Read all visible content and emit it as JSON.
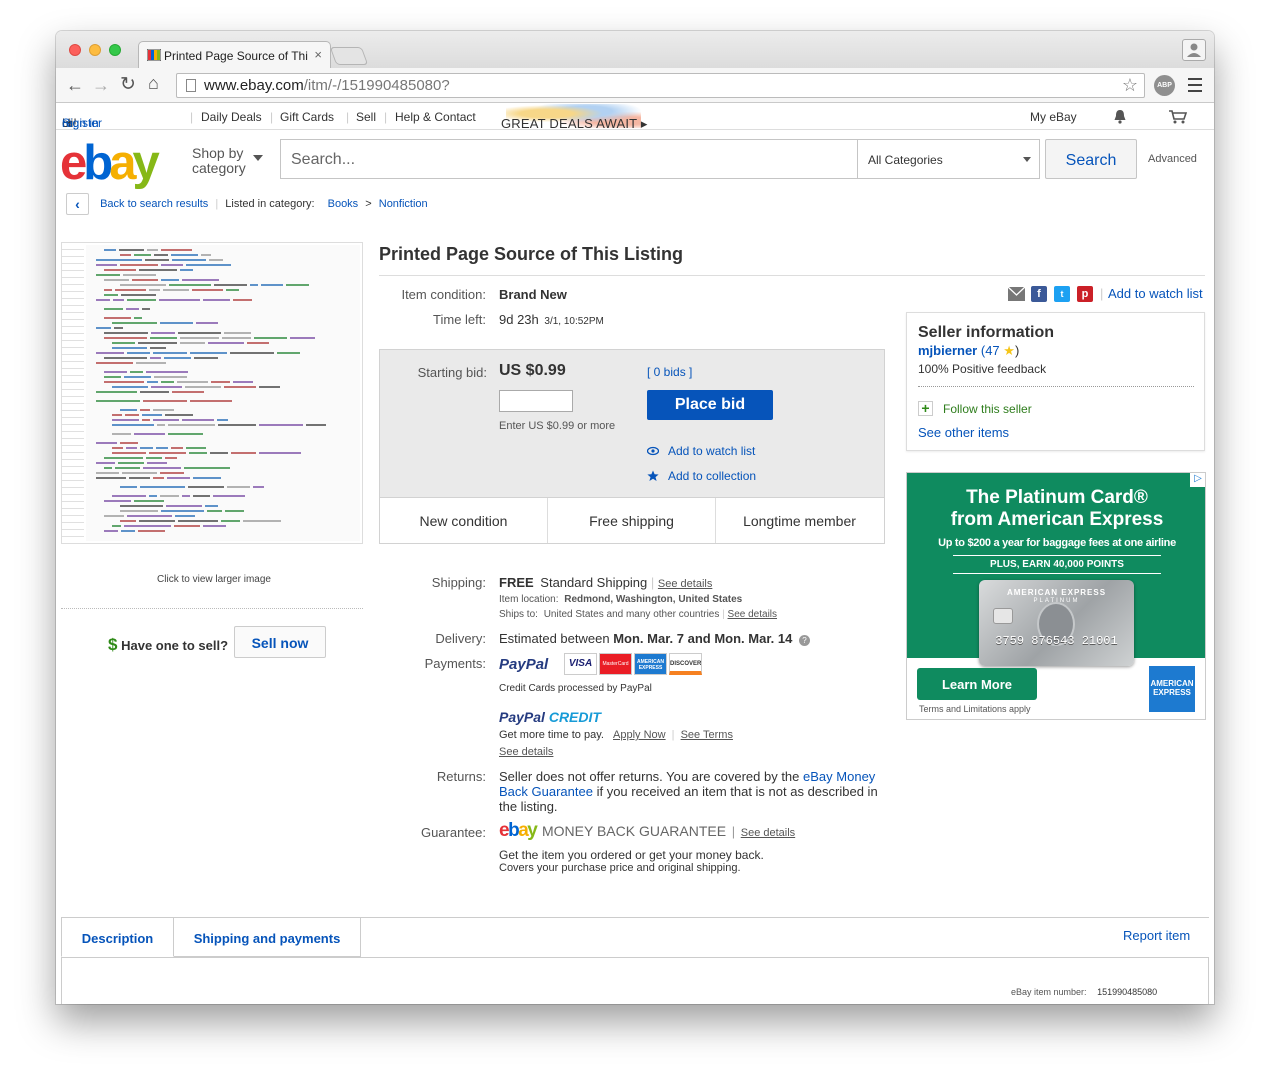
{
  "browser": {
    "tab_title": "Printed Page Source of Thi",
    "tab_close": "×",
    "url_host": "www.ebay.com",
    "url_path": "/itm/-/151990485080?",
    "abp_label": "ABP"
  },
  "topnav": {
    "greeting": "Hi!",
    "sign_in": "Sign in",
    "or": "or",
    "register": "register",
    "daily_deals": "Daily Deals",
    "gift_cards": "Gift Cards",
    "sell": "Sell",
    "help": "Help & Contact",
    "promo": "GREAT DEALS AWAIT ▸",
    "my_ebay": "My eBay"
  },
  "header": {
    "logo_letters": [
      "e",
      "b",
      "a",
      "y"
    ],
    "logo_colors": [
      "#e53238",
      "#0064d2",
      "#f5af02",
      "#86b817"
    ],
    "shop_by_1": "Shop by",
    "shop_by_2": "category",
    "search_placeholder": "Search...",
    "category": "All Categories",
    "search_button": "Search",
    "advanced": "Advanced"
  },
  "breadcrumb": {
    "back": "Back to search results",
    "listed": "Listed in category:",
    "cat1": "Books",
    "sep": ">",
    "cat2": "Nonfiction"
  },
  "left": {
    "click_larger": "Click to view larger image",
    "have_one": "Have one to sell?",
    "dollar": "$",
    "sell_now": "Sell now"
  },
  "item": {
    "title": "Printed Page Source of This Listing",
    "condition_label": "Item condition:",
    "condition": "Brand New",
    "time_left_label": "Time left:",
    "time_left": "9d 23h",
    "time_left_detail": "3/1, 10:52PM",
    "starting_bid_label": "Starting bid:",
    "starting_bid": "US $0.99",
    "bids": "[ 0 bids ]",
    "place_bid": "Place bid",
    "enter_hint": "Enter US $0.99 or more",
    "add_watch": "Add to watch list",
    "add_collection": "Add to collection",
    "features": [
      "New condition",
      "Free shipping",
      "Longtime member"
    ]
  },
  "shipping": {
    "label": "Shipping:",
    "free": "FREE",
    "method": "Standard Shipping",
    "see_details": "See details",
    "location_label": "Item location:",
    "location": "Redmond, Washington, United States",
    "ships_to_label": "Ships to:",
    "ships_to": "United States and many other countries",
    "see_details_2": "See details"
  },
  "delivery": {
    "label": "Delivery:",
    "prefix": "Estimated between",
    "dates": "Mon. Mar. 7 and Mon. Mar. 14"
  },
  "payments": {
    "label": "Payments:",
    "paypal": "PayPal",
    "cards": [
      "VISA",
      "MasterCard",
      "AMERICAN EXPRESS",
      "DISCOVER"
    ],
    "cc_note": "Credit Cards processed by PayPal",
    "credit_logo_1": "PayPal",
    "credit_logo_2": "CREDIT",
    "more_time": "Get more time to pay.",
    "apply_now": "Apply Now",
    "see_terms": "See Terms",
    "see_details": "See details"
  },
  "returns": {
    "label": "Returns:",
    "text_1": "Seller does not offer returns. You are covered by the",
    "link": "eBay Money Back Guarantee",
    "text_2": "if you received an item that is not as described in the listing."
  },
  "guarantee": {
    "label": "Guarantee:",
    "mbg": "MONEY BACK GUARANTEE",
    "see_details": "See details",
    "line1": "Get the item you ordered or get your money back.",
    "line2": "Covers your purchase price and original shipping."
  },
  "social": {
    "add_watch": "Add to watch list"
  },
  "seller": {
    "heading": "Seller information",
    "name": "mjbierner",
    "score": "(47",
    "score_close": ")",
    "feedback": "100% Positive feedback",
    "follow": "Follow this seller",
    "other_items": "See other items"
  },
  "ad": {
    "title_1": "The Platinum Card®",
    "title_2": "from American Express",
    "sub": "Up to $200 a year for baggage fees at one airline",
    "points": "PLUS, EARN 40,000 POINTS",
    "card_brand": "AMERICAN EXPRESS",
    "card_sub": "PLATINUM",
    "card_num_1": "3759",
    "card_num_2": "876543",
    "card_num_3": "21001",
    "learn_more": "Learn More",
    "terms": "Terms and Limitations apply",
    "amex_logo": "AMERICAN EXPRESS",
    "badge": "▷"
  },
  "tabs": {
    "description": "Description",
    "shipping_payments": "Shipping and payments",
    "report": "Report item",
    "item_number_label": "eBay item number:",
    "item_number": "151990485080"
  }
}
